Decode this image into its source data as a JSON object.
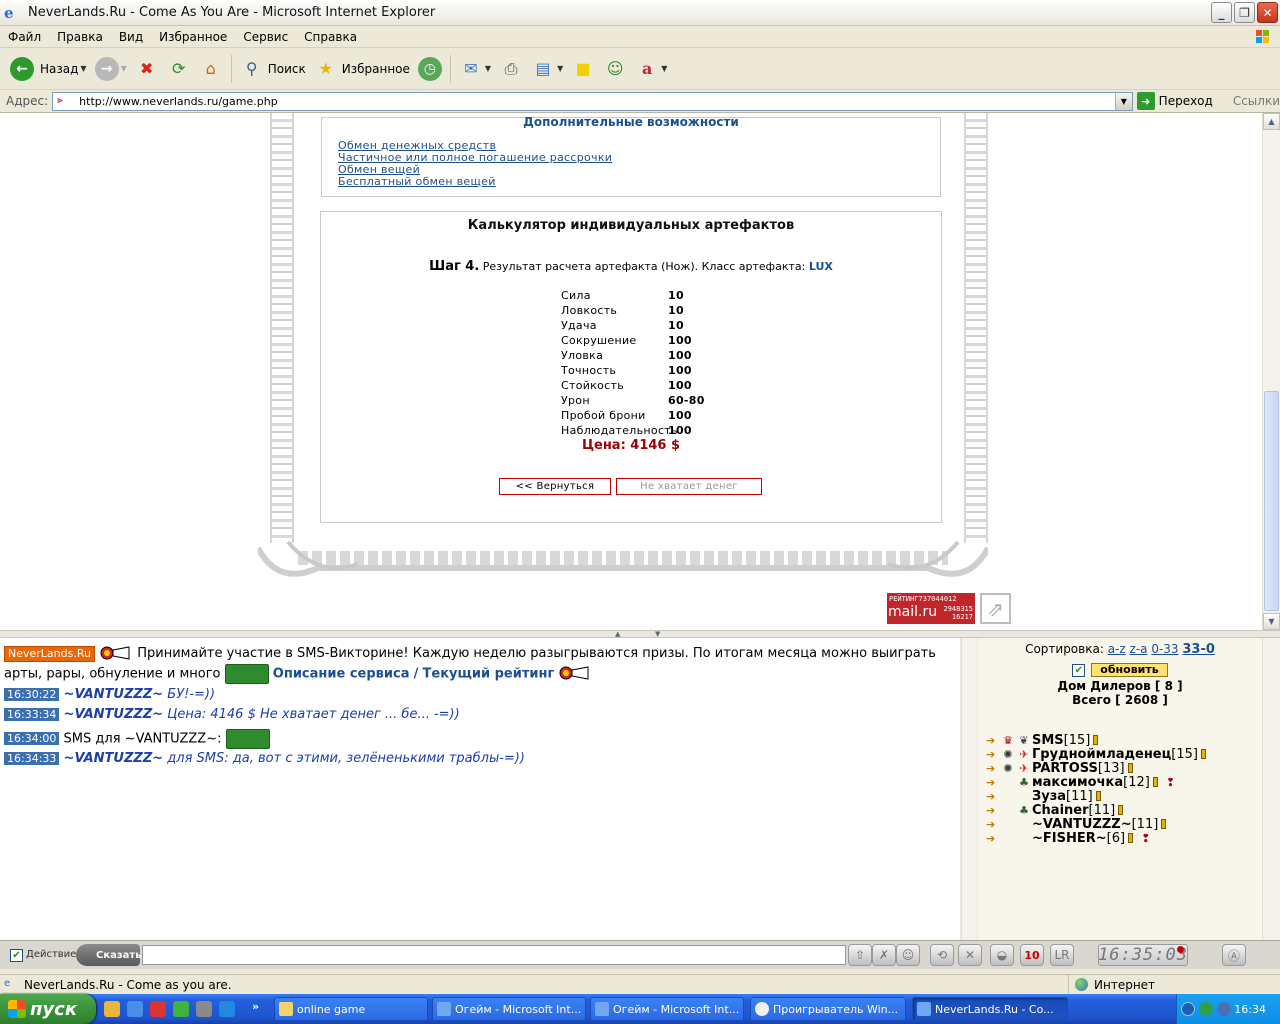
{
  "window": {
    "title": "NeverLands.Ru - Come As You Are - Microsoft Internet Explorer"
  },
  "menu": {
    "items": [
      "Файл",
      "Правка",
      "Вид",
      "Избранное",
      "Сервис",
      "Справка"
    ]
  },
  "toolbar": {
    "back_label": "Назад",
    "search_label": "Поиск",
    "favorites_label": "Избранное"
  },
  "address": {
    "label": "Адрес:",
    "url": "http://www.neverlands.ru/game.php",
    "go_label": "Переход",
    "links_label": "Ссылки"
  },
  "extra_options": {
    "title": "Дополнительные возможности",
    "links": [
      "Обмен денежных средств",
      "Частичное или полное погашение рассрочки",
      "Обмен вещей",
      "Бесплатный обмен вещей"
    ]
  },
  "calculator": {
    "title": "Калькулятор индивидуальных артефактов",
    "step_label": "Шаг 4.",
    "step_text": "Результат расчета артефакта (Нож). Класс артефакта:",
    "class_value": "LUX",
    "stats": [
      {
        "name": "Сила",
        "value": "10"
      },
      {
        "name": "Ловкость",
        "value": "10"
      },
      {
        "name": "Удача",
        "value": "10"
      },
      {
        "name": "Сокрушение",
        "value": "100"
      },
      {
        "name": "Уловка",
        "value": "100"
      },
      {
        "name": "Точность",
        "value": "100"
      },
      {
        "name": "Стойкость",
        "value": "100"
      },
      {
        "name": "Урон",
        "value": "60-80"
      },
      {
        "name": "Пробой брони",
        "value": "100"
      },
      {
        "name": "Наблюдательность",
        "value": "100"
      }
    ],
    "price": "Цена: 4146 $",
    "back_button": "<< Вернуться",
    "no_money_button": "Не хватает денег"
  },
  "rating_counter": {
    "label": "РЕЙТИНГ",
    "value1": "737",
    "value2": "044012",
    "brand": "mail.ru",
    "hits": "2948315",
    "hosts": "16217"
  },
  "chat": {
    "badge": "NeverLands.Ru",
    "announce_text": "Принимайте участие в SMS-Викторине! Каждую неделю разыгрываются призы. По итогам месяца можно выиграть арты, рары, обнуление и много",
    "service_link": "Описание сервиса",
    "separator": "/",
    "rating_link": "Текущий рейтинг",
    "messages": [
      {
        "time": "16:30:22",
        "nick": "~VANTUZZZ~",
        "text": "БУ!-=))"
      },
      {
        "time": "16:33:34",
        "nick": "~VANTUZZZ~",
        "text": "Цена: 4146 $ Не хватает денег ... бе... -=))"
      },
      {
        "time": "16:34:00",
        "nick": "SMS",
        "text": "для ~VANTUZZZ~:"
      },
      {
        "time": "16:34:33",
        "nick": "~VANTUZZZ~",
        "text": "для SMS: да, вот с этими, зелёненькими траблы-=))"
      }
    ]
  },
  "users": {
    "sort_label": "Сортировка:",
    "sort_options": [
      "a-z",
      "z-a",
      "0-33",
      "33-0"
    ],
    "refresh_label": "обновить",
    "place": "Дом Дилеров [ 8 ]",
    "total": "Всего [ 2608 ]",
    "list": [
      {
        "name": "SMS",
        "level": "[15]"
      },
      {
        "name": "Грудноймладенец",
        "level": "[15]"
      },
      {
        "name": "PARTOSS",
        "level": "[13]"
      },
      {
        "name": "максимочка",
        "level": "[12]"
      },
      {
        "name": "Зуза",
        "level": "[11]"
      },
      {
        "name": "Chainer",
        "level": "[11]"
      },
      {
        "name": "~VANTUZZZ~",
        "level": "[11]"
      },
      {
        "name": "~FISHER~",
        "level": "[6]"
      }
    ]
  },
  "chat_input": {
    "action_label": "Действие",
    "say_label": "Сказать:",
    "clock": "16:35:03",
    "level_badge": "10"
  },
  "status": {
    "text": "NeverLands.Ru - Come as you are.",
    "zone": "Интернет"
  },
  "taskbar": {
    "start_label": "пуск",
    "tasks": [
      "online game",
      "Огейм - Microsoft Int...",
      "Огейм - Microsoft Int...",
      "Проигрыватель Win...",
      "NeverLands.Ru - Co..."
    ],
    "time": "16:34"
  }
}
